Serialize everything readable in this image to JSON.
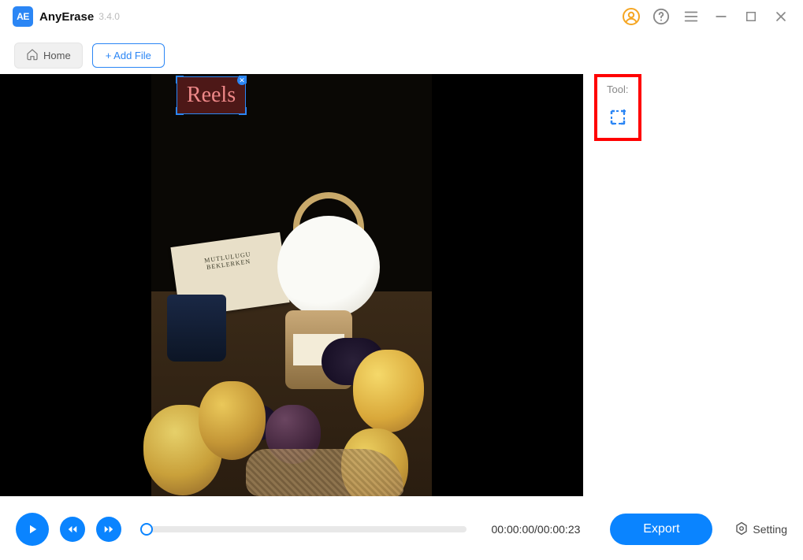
{
  "app": {
    "logo_text": "AE",
    "name": "AnyErase",
    "version": "3.4.0"
  },
  "toolbar": {
    "home_label": "Home",
    "add_file_label": "+ Add File"
  },
  "selection": {
    "watermark_text": "Reels"
  },
  "side": {
    "tool_label": "Tool:"
  },
  "playback": {
    "timecode": "00:00:00/00:00:23"
  },
  "footer": {
    "export_label": "Export",
    "setting_label": "Setting"
  },
  "colors": {
    "primary": "#0a84ff",
    "accent": "#f5a623",
    "highlight": "#ff0000"
  }
}
